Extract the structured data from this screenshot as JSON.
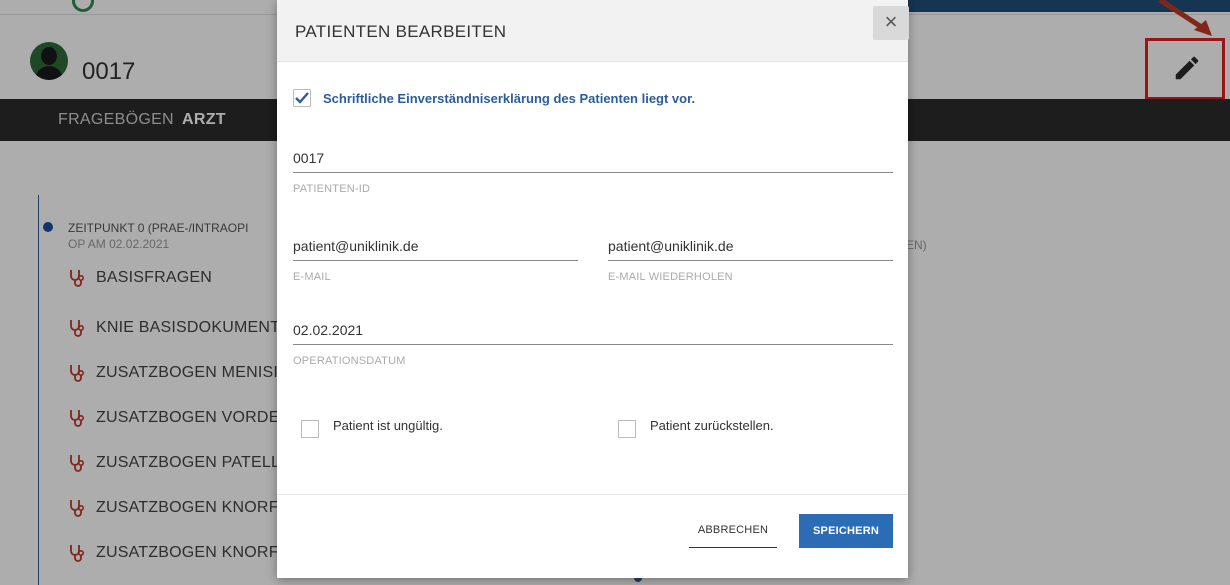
{
  "patient": {
    "id": "0017"
  },
  "tabs": {
    "questionnaires": "FRAGEBÖGEN",
    "doctor": "ARZT"
  },
  "timepoint": {
    "title": "ZEITPUNKT 0 (PRAE-/INTRAOPI",
    "date": "OP AM 02.02.2021",
    "right_fragment": "EN)"
  },
  "questionnaires": [
    "BASISFRAGEN",
    "KNIE BASISDOKUMENT",
    "ZUSATZBOGEN MENISI",
    "ZUSATZBOGEN VORDE",
    "ZUSATZBOGEN PATELL",
    "ZUSATZBOGEN KNORF",
    "ZUSATZBOGEN KNORF"
  ],
  "modal": {
    "title": "PATIENTEN BEARBEITEN",
    "close": "×",
    "consent_label": "Schriftliche Einverständniserklärung des Patienten liegt vor.",
    "consent_checked": true,
    "patient_id": {
      "value": "0017",
      "label": "PATIENTEN-ID"
    },
    "email": {
      "value": "patient@uniklinik.de",
      "label": "E-MAIL"
    },
    "email_repeat": {
      "value": "patient@uniklinik.de",
      "label": "E-MAIL WIEDERHOLEN"
    },
    "op_date": {
      "value": "02.02.2021",
      "label": "OPERATIONSDATUM"
    },
    "invalid_label": "Patient ist ungültig.",
    "defer_label": "Patient zurückstellen.",
    "cancel": "ABBRECHEN",
    "save": "SPEICHERN"
  },
  "colors": {
    "accent": "#2b6cb5",
    "highlight": "#e02020",
    "stethoscope": "#c0392b",
    "darkbar": "#2b2b2b"
  }
}
